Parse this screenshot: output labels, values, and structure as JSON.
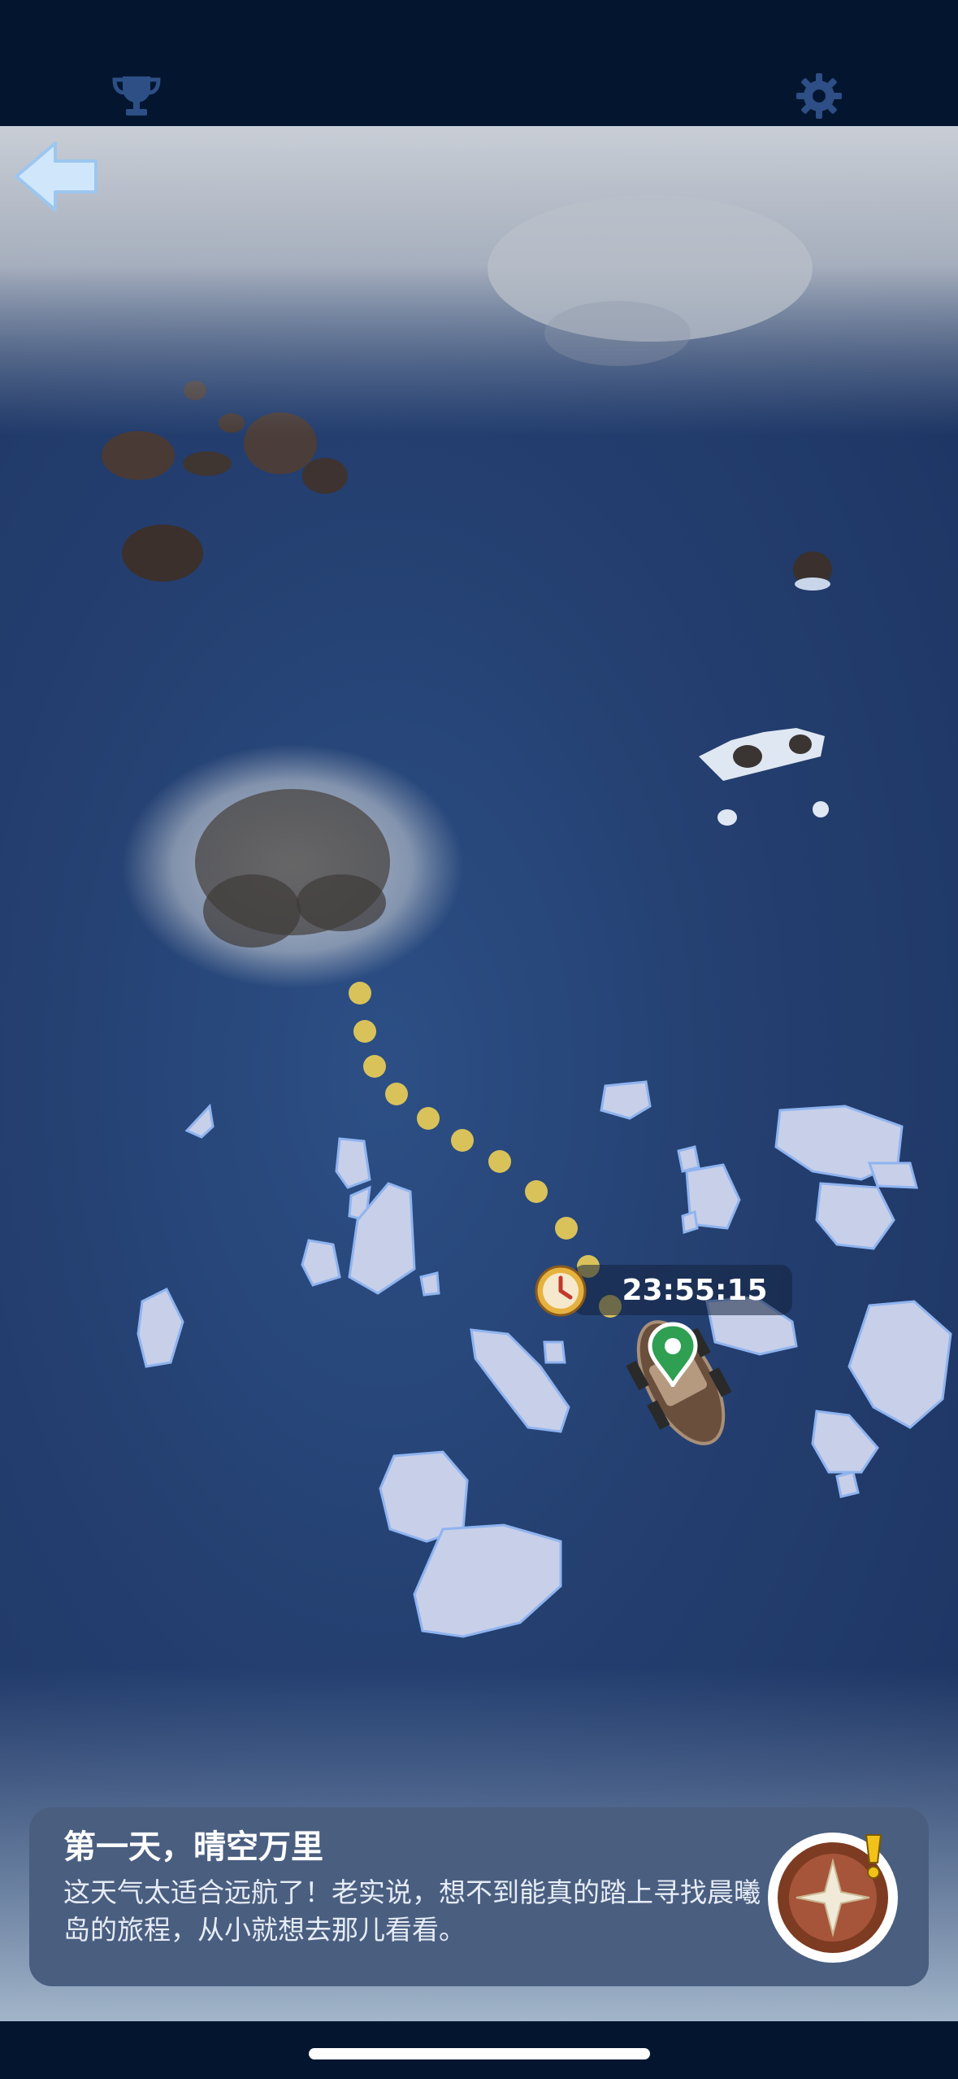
{
  "hud": {
    "trophy_icon": "trophy-icon",
    "settings_icon": "gear-icon",
    "back_icon": "back-arrow-icon"
  },
  "voyage": {
    "timer": "23:55:15",
    "clock_icon": "clock-icon",
    "ship_marker_icon": "location-pin-icon"
  },
  "dialog": {
    "title": "第一天，晴空万里",
    "text": "这天气太适合远航了！老实说，想不到能真的踏上寻找晨曦岛的旅程，从小就想去那儿看看。",
    "compass_icon": "compass-icon",
    "alert_icon": "exclamation-icon"
  },
  "colors": {
    "sea": "#243f70",
    "bar": "#04162f",
    "dialog_bg": "#4a5e80",
    "path_dot": "#d9c25a"
  }
}
